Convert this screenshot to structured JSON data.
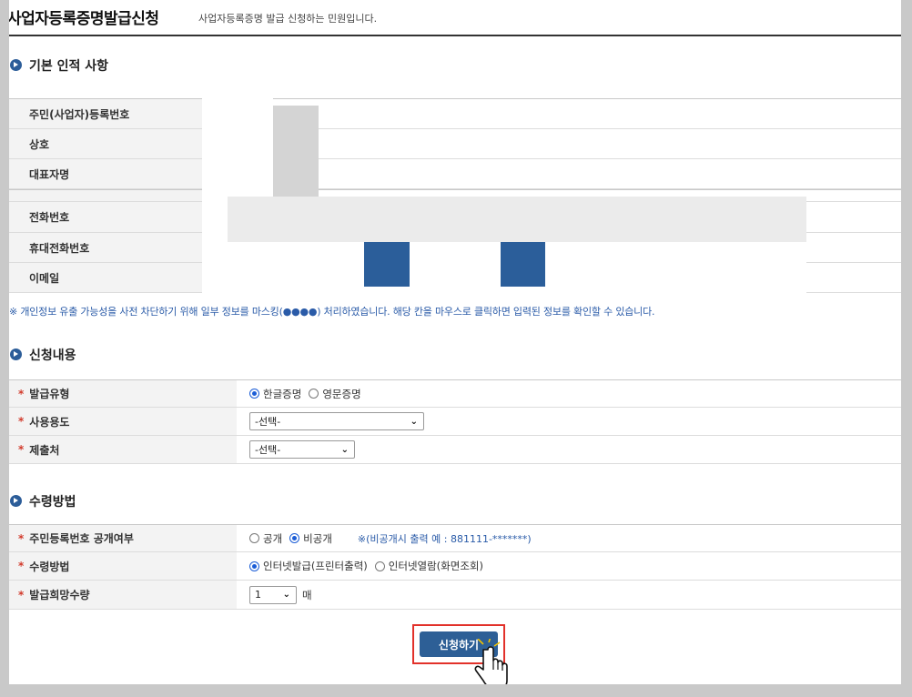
{
  "header": {
    "title": "사업자등록증명발급신청",
    "subtitle": "사업자등록증명 발급 신청하는 민원입니다."
  },
  "basic": {
    "heading": "기본 인적 사항",
    "rows": [
      {
        "label": "주민(사업자)등록번호"
      },
      {
        "label": "상호"
      },
      {
        "label": "대표자명"
      },
      {
        "label": "전화번호"
      },
      {
        "label": "휴대전화번호"
      },
      {
        "label": "이메일"
      }
    ],
    "notice": "※ 개인정보 유출 가능성을 사전 차단하기 위해 일부 정보를 마스킹(●●●●) 처리하였습니다. 해당 칸을 마우스로 클릭하면 입력된 정보를 확인할 수 있습니다."
  },
  "application": {
    "heading": "신청내용",
    "issue_type": {
      "label": "발급유형",
      "options": [
        "한글증명",
        "영문증명"
      ],
      "selected": "한글증명"
    },
    "purpose": {
      "label": "사용용도",
      "value": "-선택-"
    },
    "destination": {
      "label": "제출처",
      "value": "-선택-"
    }
  },
  "receipt": {
    "heading": "수령방법",
    "disclosure": {
      "label": "주민등록번호 공개여부",
      "options": [
        "공개",
        "비공개"
      ],
      "selected": "비공개",
      "hint": "※(비공개시 출력 예 : 881111-*******)"
    },
    "method": {
      "label": "수령방법",
      "options": [
        "인터넷발급(프린터출력)",
        "인터넷열람(화면조회)"
      ],
      "selected": "인터넷발급(프린터출력)"
    },
    "quantity": {
      "label": "발급희망수량",
      "value": "1",
      "unit": "매"
    }
  },
  "submit": {
    "label": "신청하기"
  },
  "colors": {
    "accent": "#2c5d99",
    "highlight": "#e2312a",
    "notice": "#2a5ba8",
    "mask_blue": "#2b5e9a",
    "mask_gray": "#d4d4d4"
  },
  "icons": {
    "section": "circle-arrow-icon",
    "cursor": "hand-pointer-icon"
  }
}
